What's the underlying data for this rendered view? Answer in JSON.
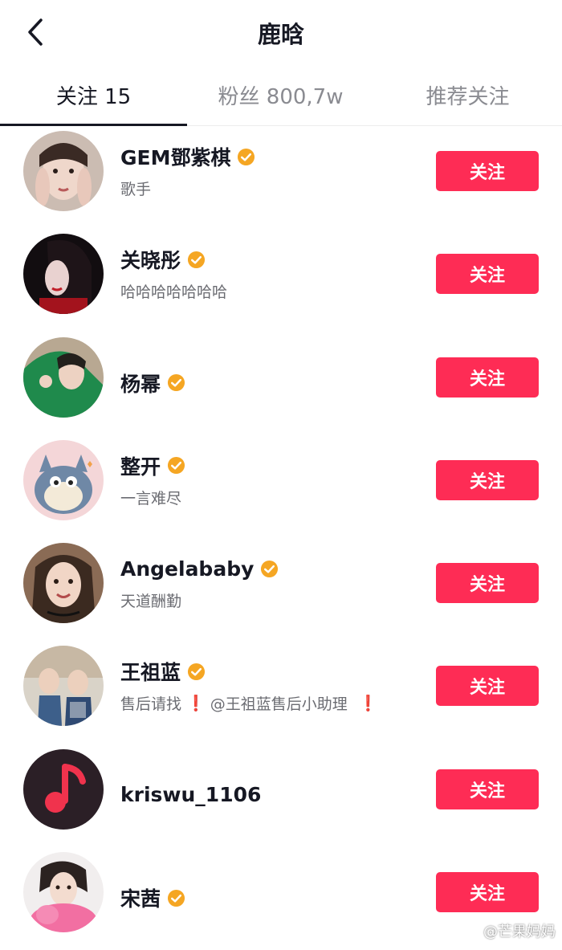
{
  "header": {
    "title": "鹿晗",
    "back_icon": "chevron-left-icon"
  },
  "tabs": [
    {
      "label": "关注 15",
      "active": true
    },
    {
      "label": "粉丝 800,7w",
      "active": false
    },
    {
      "label": "推荐关注",
      "active": false
    }
  ],
  "users": [
    {
      "name": "GEM鄧紫棋",
      "verified": true,
      "bio": "歌手",
      "button": "关注"
    },
    {
      "name": "关晓彤",
      "verified": true,
      "bio": "哈哈哈哈哈哈哈",
      "button": "关注"
    },
    {
      "name": "杨幂",
      "verified": true,
      "bio": "",
      "button": "关注"
    },
    {
      "name": "整开",
      "verified": true,
      "bio": "一言难尽",
      "button": "关注"
    },
    {
      "name": "Angelababy",
      "verified": true,
      "bio": "天道酬勤",
      "button": "关注"
    },
    {
      "name": "王祖蓝",
      "verified": true,
      "bio_before": "售后请找",
      "bio_mid": "@王祖蓝售后小助理",
      "exclaim": "❗",
      "button": "关注"
    },
    {
      "name": "kriswu_1106",
      "verified": false,
      "bio": "",
      "button": "关注"
    },
    {
      "name": "宋茜",
      "verified": true,
      "bio": "",
      "button": "关注"
    }
  ],
  "watermark": "@芒果妈妈",
  "colors": {
    "follow_button": "#fe2c55",
    "verified_badge": "#f5a623",
    "primary_text": "#161823",
    "secondary_text": "#6b6c72"
  }
}
